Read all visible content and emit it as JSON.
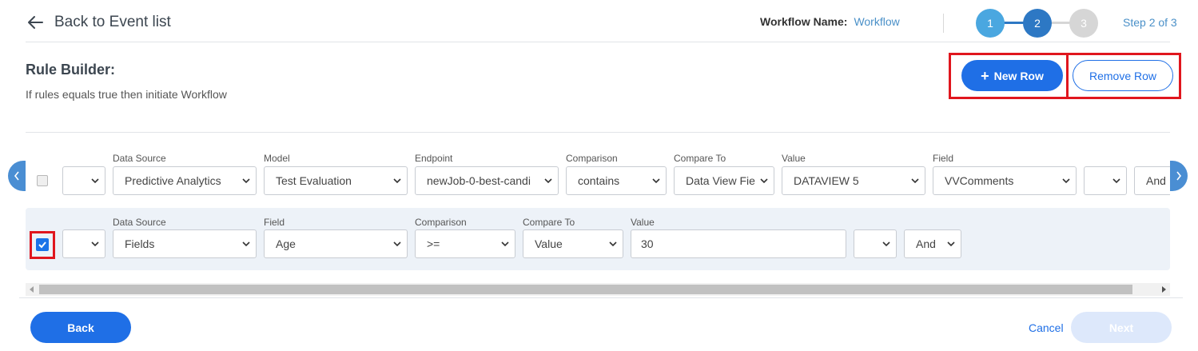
{
  "header": {
    "back_label": "Back to Event list",
    "workflow_name_label": "Workflow Name:",
    "workflow_name_value": "Workflow",
    "steps": [
      "1",
      "2",
      "3"
    ],
    "current_step": 2,
    "step_text": "Step 2 of 3"
  },
  "rule_builder": {
    "title": "Rule Builder:",
    "subtitle": "If rules equals true then initiate Workflow",
    "new_row_label": "New Row",
    "remove_row_label": "Remove Row"
  },
  "rows": [
    {
      "checked": false,
      "paren_open": "",
      "fields": [
        {
          "label": "Data Source",
          "value": "Predictive Analytics"
        },
        {
          "label": "Model",
          "value": "Test Evaluation"
        },
        {
          "label": "Endpoint",
          "value": "newJob-0-best-candi"
        },
        {
          "label": "Comparison",
          "value": "contains"
        },
        {
          "label": "Compare To",
          "value": "Data View Fie"
        },
        {
          "label": "Value",
          "value": "DATAVIEW 5"
        },
        {
          "label": "Field",
          "value": "VVComments"
        }
      ],
      "paren_close": "",
      "conjunction": "And"
    },
    {
      "checked": true,
      "paren_open": "",
      "fields": [
        {
          "label": "Data Source",
          "value": "Fields"
        },
        {
          "label": "Field",
          "value": "Age"
        },
        {
          "label": "Comparison",
          "value": ">="
        },
        {
          "label": "Compare To",
          "value": "Value"
        },
        {
          "label": "Value",
          "value": "30"
        }
      ],
      "paren_close": "",
      "conjunction": "And"
    }
  ],
  "footer": {
    "back_label": "Back",
    "cancel_label": "Cancel",
    "next_label": "Next"
  },
  "colors": {
    "primary": "#1f6fe6",
    "step_done": "#4aa7e0",
    "step_active": "#2d78c4",
    "step_pending": "#d6d6d6",
    "highlight": "#e0161e",
    "row_selected_bg": "#edf2f8"
  }
}
